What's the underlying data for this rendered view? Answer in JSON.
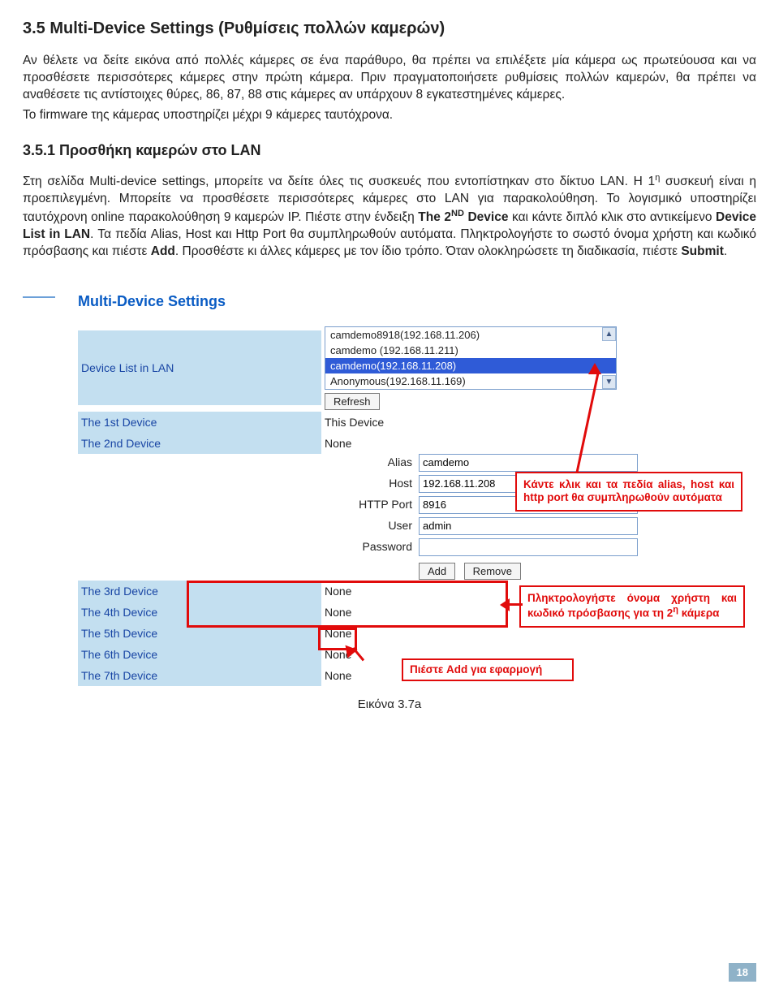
{
  "section_title": "3.5 Multi-Device Settings (Ρυθμίσεις πολλών καμερών)",
  "para1": "Αν θέλετε να δείτε εικόνα από πολλές κάμερες σε ένα παράθυρο, θα πρέπει να επιλέξετε μία κάμερα ως πρωτεύουσα και να προσθέσετε περισσότερες κάμερες στην πρώτη κάμερα. Πριν πραγματοποιήσετε ρυθμίσεις πολλών καμερών, θα πρέπει να αναθέσετε τις αντίστοιχες θύρες, 86, 87, 88 στις κάμερες αν υπάρχουν 8 εγκατεστημένες κάμερες.",
  "para1b": "Το firmware της κάμερας υποστηρίζει μέχρι 9 κάμερες ταυτόχρονα.",
  "subsection_title": "3.5.1 Προσθήκη καμερών στο LAN",
  "para2_a": "Στη σελίδα Multi-device settings, μπορείτε να δείτε όλες τις συσκευές που εντοπίστηκαν στο δίκτυο LAN. Η 1",
  "para2_sup1": "η",
  "para2_b": " συσκευή είναι η προεπιλεγμένη. Μπορείτε να προσθέσετε περισσότερες κάμερες στο LAN για παρακολούθηση. Το λογισμικό υποστηρίζει ταυτόχρονη online παρακολούθηση 9 καμερών IP. Πιέστε στην ένδειξη ",
  "para2_bold1": "The 2",
  "para2_sup2": "ND",
  "para2_bold1b": " Device",
  "para2_c": " και κάντε διπλό κλικ στο αντικείμενο ",
  "para2_bold2": "Device List in LAN",
  "para2_d": ". Τα πεδία Alias, Host και Http Port θα συμπληρωθούν αυτόματα. Πληκτρολογήστε το σωστό όνομα χρήστη και κωδικό πρόσβασης και πιέστε ",
  "para2_bold3": "Add",
  "para2_e": ". Προσθέστε κι άλλες κάμερες με τον ίδιο τρόπο. Όταν ολοκληρώσετε τη διαδικασία, πιέστε ",
  "para2_bold4": "Submit",
  "para2_f": ".",
  "panel": {
    "title": "Multi-Device Settings",
    "device_list_label": "Device List in LAN",
    "options": [
      "camdemo8918(192.168.11.206)",
      "camdemo (192.168.11.211)",
      "camdemo(192.168.11.208)",
      "Anonymous(192.168.11.169)"
    ],
    "selected_index": 2,
    "refresh_btn": "Refresh",
    "row_1st": "The 1st Device",
    "val_1st": "This Device",
    "row_2nd": "The 2nd Device",
    "val_2nd": "None",
    "alias_label": "Alias",
    "alias_val": "camdemo",
    "host_label": "Host",
    "host_val": "192.168.11.208",
    "port_label": "HTTP Port",
    "port_val": "8916",
    "user_label": "User",
    "user_val": "admin",
    "pass_label": "Password",
    "pass_val": "",
    "add_btn": "Add",
    "remove_btn": "Remove",
    "row_3rd": "The 3rd Device",
    "val_3rd": "None",
    "row_4th": "The 4th Device",
    "val_4th": "None",
    "row_5th": "The 5th Device",
    "val_5th": "None",
    "row_6th": "The 6th Device",
    "val_6th": "None",
    "row_7th": "The 7th Device",
    "val_7th": "None"
  },
  "callouts": {
    "c1": "Κάντε κλικ και τα πεδία alias, host και http port θα συμπληρωθούν αυτόματα",
    "c2a": "Πληκτρολογήστε όνομα χρήστη και κωδικό πρόσβασης για τη 2",
    "c2sup": "η",
    "c2b": " κάμερα",
    "c3": "Πιέστε Add για εφαρμογή"
  },
  "fig_caption": "Εικόνα 3.7a",
  "page_number": "18"
}
